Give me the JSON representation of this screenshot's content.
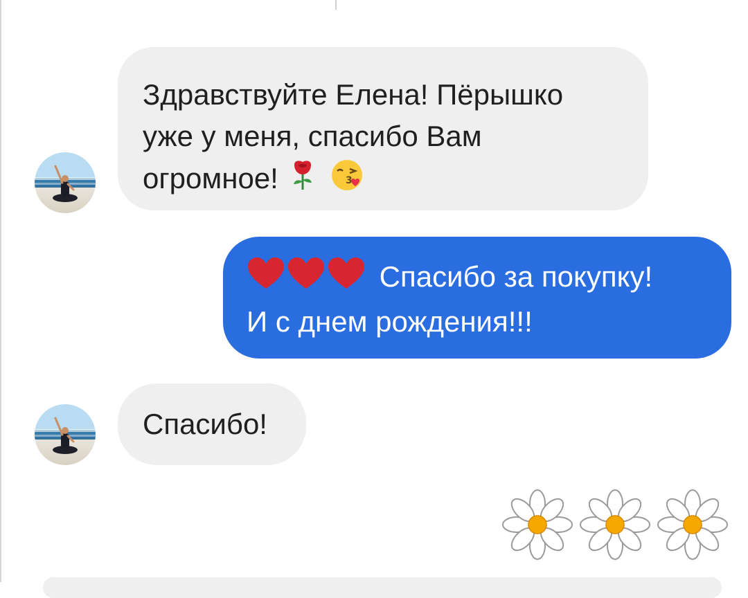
{
  "chat": {
    "messages": [
      {
        "direction": "incoming",
        "lines": [
          "Здравствуйте Елена! Пёрышко",
          "уже у меня, спасибо Вам",
          "огромное!"
        ],
        "emojis": [
          "rose-icon",
          "kissing-face-icon"
        ]
      },
      {
        "direction": "outgoing",
        "lead_emojis": [
          "red-heart-icon",
          "red-heart-icon",
          "red-heart-icon"
        ],
        "lines": [
          "Спасибо за покупку!",
          "И с днем рождения!!!"
        ]
      },
      {
        "direction": "incoming",
        "lines": [
          "Спасибо!"
        ]
      },
      {
        "direction": "outgoing",
        "emojis": [
          "daisy-icon",
          "daisy-icon",
          "daisy-icon"
        ]
      }
    ]
  },
  "colors": {
    "incoming_bubble": "#efefef",
    "outgoing_bubble": "#2a6de0",
    "incoming_text": "#1f1f1f",
    "outgoing_text": "#ffffff",
    "heart": "#d7262f",
    "daisy_center": "#f5a800"
  }
}
